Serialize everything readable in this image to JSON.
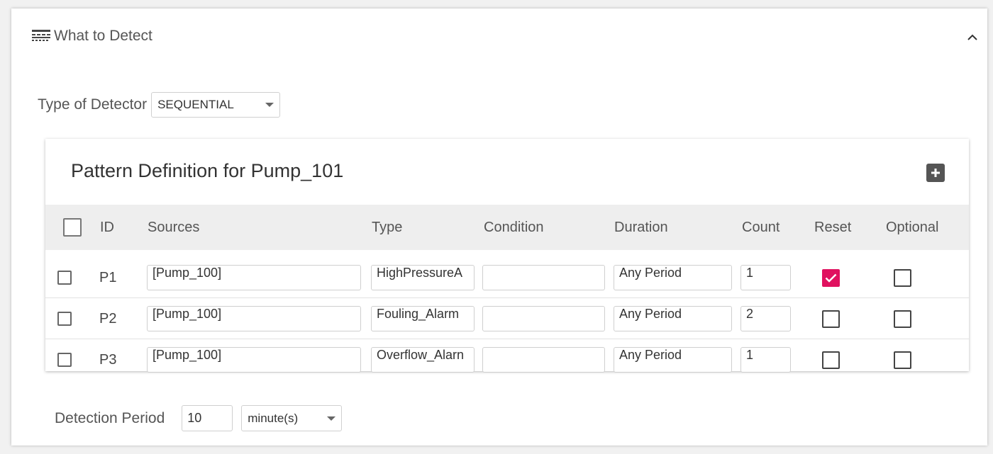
{
  "section": {
    "title": "What to Detect",
    "header_icon": "table-grid-icon",
    "collapse_icon": "chevron-up-icon"
  },
  "detector": {
    "label": "Type of Detector",
    "value": "SEQUENTIAL"
  },
  "pattern": {
    "title": "Pattern Definition for Pump_101",
    "add_icon": "plus-square-icon",
    "columns": [
      "ID",
      "Sources",
      "Type",
      "Condition",
      "Duration",
      "Count",
      "Reset",
      "Optional"
    ],
    "rows": [
      {
        "id": "P1",
        "sources": "[Pump_100]",
        "type": "HighPressureA",
        "condition": "",
        "duration": "Any Period",
        "count": "1",
        "reset": true,
        "optional": false,
        "selected": false
      },
      {
        "id": "P2",
        "sources": "[Pump_100]",
        "type": "Fouling_Alarm",
        "condition": "",
        "duration": "Any Period",
        "count": "2",
        "reset": false,
        "optional": false,
        "selected": false
      },
      {
        "id": "P3",
        "sources": "[Pump_100]",
        "type": "Overflow_Alarn",
        "condition": "",
        "duration": "Any Period",
        "count": "1",
        "reset": false,
        "optional": false,
        "selected": false
      }
    ]
  },
  "detection_period": {
    "label": "Detection Period",
    "value": "10",
    "unit": "minute(s)"
  },
  "colors": {
    "accent": "#e0115f",
    "header_bg": "#eeeeee"
  }
}
